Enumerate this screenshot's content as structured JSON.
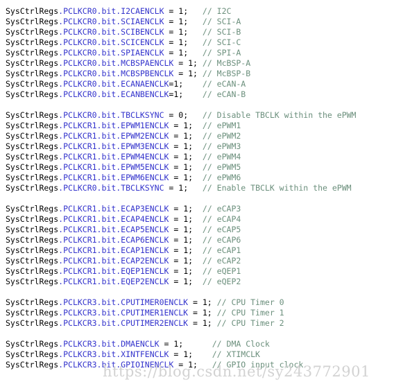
{
  "editor": {
    "background_color": "#ffffff",
    "language": "c",
    "font_size_px": 11.5,
    "line_height_px": 15
  },
  "syntax_colors": {
    "object": "#000000",
    "member": "#3333cc",
    "operator": "#000000",
    "number": "#000000",
    "punctuation": "#000000",
    "comment": "#6b8f7c",
    "watermark": "#d2d2d2"
  },
  "watermark": {
    "text": "https://blog.csdn.net/sy243772901"
  },
  "lines": [
    {
      "blank": false,
      "object": "SysCtrlRegs",
      "member": ".PCLKCR0.bit.I2CAENCLK",
      "assign": " = 1;",
      "gap": "   ",
      "comment": "// I2C"
    },
    {
      "blank": false,
      "object": "SysCtrlRegs",
      "member": ".PCLKCR0.bit.SCIAENCLK",
      "assign": " = 1;",
      "gap": "   ",
      "comment": "// SCI-A"
    },
    {
      "blank": false,
      "object": "SysCtrlRegs",
      "member": ".PCLKCR0.bit.SCIBENCLK",
      "assign": " = 1;",
      "gap": "   ",
      "comment": "// SCI-B"
    },
    {
      "blank": false,
      "object": "SysCtrlRegs",
      "member": ".PCLKCR0.bit.SCICENCLK",
      "assign": " = 1;",
      "gap": "   ",
      "comment": "// SCI-C"
    },
    {
      "blank": false,
      "object": "SysCtrlRegs",
      "member": ".PCLKCR0.bit.SPIAENCLK",
      "assign": " = 1;",
      "gap": "   ",
      "comment": "// SPI-A"
    },
    {
      "blank": false,
      "object": "SysCtrlRegs",
      "member": ".PCLKCR0.bit.MCBSPAENCLK",
      "assign": " = 1;",
      "gap": " ",
      "comment": "// McBSP-A"
    },
    {
      "blank": false,
      "object": "SysCtrlRegs",
      "member": ".PCLKCR0.bit.MCBSPBENCLK",
      "assign": " = 1;",
      "gap": " ",
      "comment": "// McBSP-B"
    },
    {
      "blank": false,
      "object": "SysCtrlRegs",
      "member": ".PCLKCR0.bit.ECANAENCLK",
      "assign": "=1;",
      "gap": "    ",
      "comment": "// eCAN-A"
    },
    {
      "blank": false,
      "object": "SysCtrlRegs",
      "member": ".PCLKCR0.bit.ECANBENCLK",
      "assign": "=1;",
      "gap": "    ",
      "comment": "// eCAN-B"
    },
    {
      "blank": true
    },
    {
      "blank": false,
      "object": "SysCtrlRegs",
      "member": ".PCLKCR0.bit.TBCLKSYNC",
      "assign": " = 0;",
      "gap": "   ",
      "comment": "// Disable TBCLK within the ePWM"
    },
    {
      "blank": false,
      "object": "SysCtrlRegs",
      "member": ".PCLKCR1.bit.EPWM1ENCLK",
      "assign": " = 1;",
      "gap": "  ",
      "comment": "// ePWM1"
    },
    {
      "blank": false,
      "object": "SysCtrlRegs",
      "member": ".PCLKCR1.bit.EPWM2ENCLK",
      "assign": " = 1;",
      "gap": "  ",
      "comment": "// ePWM2"
    },
    {
      "blank": false,
      "object": "SysCtrlRegs",
      "member": ".PCLKCR1.bit.EPWM3ENCLK",
      "assign": " = 1;",
      "gap": "  ",
      "comment": "// ePWM3"
    },
    {
      "blank": false,
      "object": "SysCtrlRegs",
      "member": ".PCLKCR1.bit.EPWM4ENCLK",
      "assign": " = 1;",
      "gap": "  ",
      "comment": "// ePWM4"
    },
    {
      "blank": false,
      "object": "SysCtrlRegs",
      "member": ".PCLKCR1.bit.EPWM5ENCLK",
      "assign": " = 1;",
      "gap": "  ",
      "comment": "// ePWM5"
    },
    {
      "blank": false,
      "object": "SysCtrlRegs",
      "member": ".PCLKCR1.bit.EPWM6ENCLK",
      "assign": " = 1;",
      "gap": "  ",
      "comment": "// ePWM6"
    },
    {
      "blank": false,
      "object": "SysCtrlRegs",
      "member": ".PCLKCR0.bit.TBCLKSYNC",
      "assign": " = 1;",
      "gap": "   ",
      "comment": "// Enable TBCLK within the ePWM"
    },
    {
      "blank": true
    },
    {
      "blank": false,
      "object": "SysCtrlRegs",
      "member": ".PCLKCR1.bit.ECAP3ENCLK",
      "assign": " = 1;",
      "gap": "  ",
      "comment": "// eCAP3"
    },
    {
      "blank": false,
      "object": "SysCtrlRegs",
      "member": ".PCLKCR1.bit.ECAP4ENCLK",
      "assign": " = 1;",
      "gap": "  ",
      "comment": "// eCAP4"
    },
    {
      "blank": false,
      "object": "SysCtrlRegs",
      "member": ".PCLKCR1.bit.ECAP5ENCLK",
      "assign": " = 1;",
      "gap": "  ",
      "comment": "// eCAP5"
    },
    {
      "blank": false,
      "object": "SysCtrlRegs",
      "member": ".PCLKCR1.bit.ECAP6ENCLK",
      "assign": " = 1;",
      "gap": "  ",
      "comment": "// eCAP6"
    },
    {
      "blank": false,
      "object": "SysCtrlRegs",
      "member": ".PCLKCR1.bit.ECAP1ENCLK",
      "assign": " = 1;",
      "gap": "  ",
      "comment": "// eCAP1"
    },
    {
      "blank": false,
      "object": "SysCtrlRegs",
      "member": ".PCLKCR1.bit.ECAP2ENCLK",
      "assign": " = 1;",
      "gap": "  ",
      "comment": "// eCAP2"
    },
    {
      "blank": false,
      "object": "SysCtrlRegs",
      "member": ".PCLKCR1.bit.EQEP1ENCLK",
      "assign": " = 1;",
      "gap": "  ",
      "comment": "// eQEP1"
    },
    {
      "blank": false,
      "object": "SysCtrlRegs",
      "member": ".PCLKCR1.bit.EQEP2ENCLK",
      "assign": " = 1;",
      "gap": "  ",
      "comment": "// eQEP2"
    },
    {
      "blank": true
    },
    {
      "blank": false,
      "object": "SysCtrlRegs",
      "member": ".PCLKCR3.bit.CPUTIMER0ENCLK",
      "assign": " = 1;",
      "gap": " ",
      "comment": "// CPU Timer 0"
    },
    {
      "blank": false,
      "object": "SysCtrlRegs",
      "member": ".PCLKCR3.bit.CPUTIMER1ENCLK",
      "assign": " = 1;",
      "gap": " ",
      "comment": "// CPU Timer 1"
    },
    {
      "blank": false,
      "object": "SysCtrlRegs",
      "member": ".PCLKCR3.bit.CPUTIMER2ENCLK",
      "assign": " = 1;",
      "gap": " ",
      "comment": "// CPU Timer 2"
    },
    {
      "blank": true
    },
    {
      "blank": false,
      "object": "SysCtrlRegs",
      "member": ".PCLKCR3.bit.DMAENCLK",
      "assign": " = 1;",
      "gap": "      ",
      "comment": "// DMA Clock"
    },
    {
      "blank": false,
      "object": "SysCtrlRegs",
      "member": ".PCLKCR3.bit.XINTFENCLK",
      "assign": " = 1;",
      "gap": "    ",
      "comment": "// XTIMCLK"
    },
    {
      "blank": false,
      "object": "SysCtrlRegs",
      "member": ".PCLKCR3.bit.GPIOINENCLK",
      "assign": " = 1;",
      "gap": "   ",
      "comment": "// GPIO input clock"
    }
  ]
}
